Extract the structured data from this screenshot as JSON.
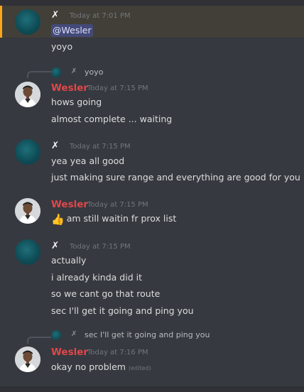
{
  "messages": [
    {
      "author": "✗",
      "time": "Today at 7:01 PM",
      "lines": [
        "yoyo"
      ],
      "mention": "@Wesler"
    },
    {
      "reply": {
        "author": "✗",
        "text": "yoyo"
      },
      "author": "Wesler",
      "time": "Today at 7:15 PM",
      "lines": [
        "hows going",
        "almost complete ... waiting"
      ]
    },
    {
      "author": "✗",
      "time": "Today at 7:15 PM",
      "lines": [
        "yea yea all good",
        "just making sure range and everything are good for you"
      ]
    },
    {
      "author": "Wesler",
      "time": "Today at 7:15 PM",
      "lines": [
        "am still waitin fr prox list"
      ],
      "emoji": "thumbs-up-emoji"
    },
    {
      "author": "✗",
      "time": "Today at 7:15 PM",
      "lines": [
        "actually",
        "i already kinda did it",
        "so we cant go that route",
        "sec I'll get it going and ping you"
      ]
    },
    {
      "reply": {
        "author": "✗",
        "text": "sec I'll get it going and ping you"
      },
      "author": "Wesler",
      "time": "Today at 7:16 PM",
      "lines": [
        "okay no problem"
      ],
      "edited": "(edited)"
    }
  ],
  "colors": {
    "background": "#36393f",
    "mention_highlight": "#423f38",
    "mention_border": "#faa61a",
    "username": "#e0474a"
  },
  "icons": {
    "x_user_avatar": "teal-circle-avatar",
    "wesler_avatar": "person-avatar"
  }
}
